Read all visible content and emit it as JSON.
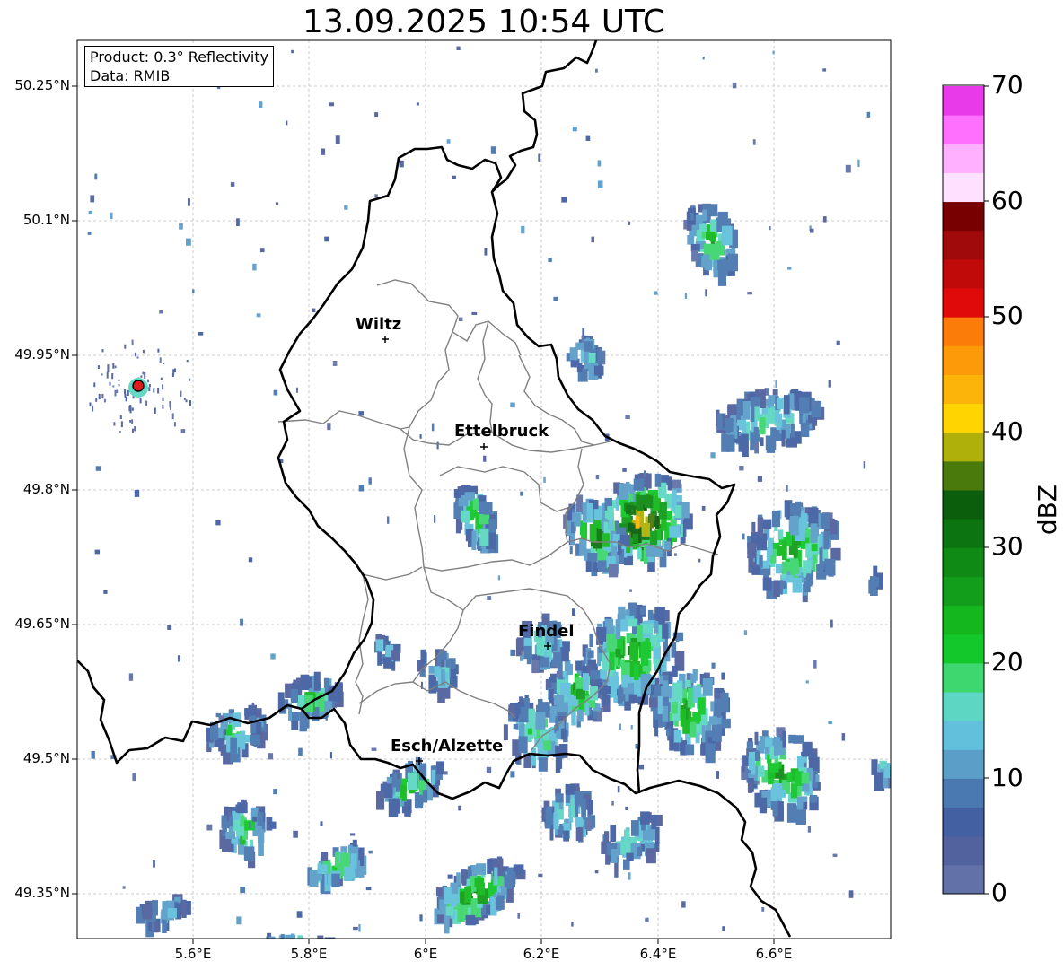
{
  "title": "13.09.2025 10:54 UTC",
  "info_box": {
    "product": "Product: 0.3° Reflectivity",
    "data": "Data: RMIB"
  },
  "axes": {
    "lat_labels": [
      "50.25°N",
      "50.1°N",
      "49.95°N",
      "49.8°N",
      "49.65°N",
      "49.5°N",
      "49.35°N"
    ],
    "lon_labels": [
      "5.6°E",
      "5.8°E",
      "6°E",
      "6.2°E",
      "6.4°E",
      "6.6°E"
    ],
    "grid": true
  },
  "cities": [
    {
      "name": "Wiltz"
    },
    {
      "name": "Ettelbruck"
    },
    {
      "name": "Findel"
    },
    {
      "name": "Esch/Alzette"
    }
  ],
  "radar_site_color": "#e31a1c",
  "colorbar": {
    "unit": "dBZ",
    "ticks": [
      "0",
      "10",
      "20",
      "30",
      "40",
      "50",
      "60",
      "70"
    ],
    "colors": [
      "#6272a8",
      "#52629e",
      "#4360a2",
      "#4a78b0",
      "#5b9ec8",
      "#63c0dc",
      "#5ed6c4",
      "#3ed66e",
      "#12c82a",
      "#14b81e",
      "#129e1a",
      "#0f8a14",
      "#0c7410",
      "#0a5e0c",
      "#4a7a0c",
      "#b0b00a",
      "#ffd400",
      "#fcb40a",
      "#fc9a0a",
      "#fc7c0a",
      "#e00a0a",
      "#c00a0a",
      "#a00a0a",
      "#780000",
      "#ffe0ff",
      "#ffb0ff",
      "#ff70ff",
      "#e83ae8"
    ]
  }
}
